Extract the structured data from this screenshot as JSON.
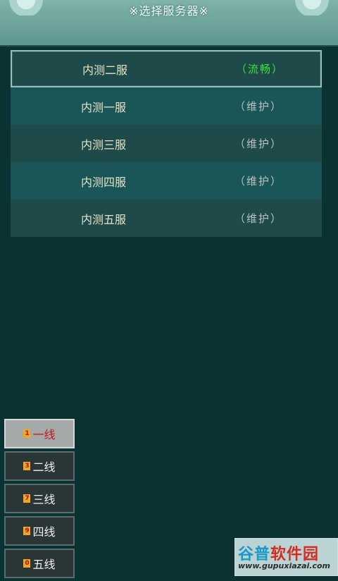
{
  "header": {
    "title": "※选择服务器※"
  },
  "servers": [
    {
      "name": "内测二服",
      "status": "（流畅）",
      "state": "ok"
    },
    {
      "name": "内测一服",
      "status": "（维护）",
      "state": "maintenance"
    },
    {
      "name": "内测三服",
      "status": "（维护）",
      "state": "maintenance"
    },
    {
      "name": "内测四服",
      "status": "（维护）",
      "state": "maintenance"
    },
    {
      "name": "内测五服",
      "status": "（维护）",
      "state": "maintenance"
    }
  ],
  "lines": [
    {
      "key": "1",
      "label": "一线"
    },
    {
      "key": "3",
      "label": "二线"
    },
    {
      "key": "7",
      "label": "三线"
    },
    {
      "key": "9",
      "label": "四线"
    },
    {
      "key": "0",
      "label": "五线"
    }
  ],
  "watermark": {
    "logo_a": "谷普",
    "logo_b": "软件园",
    "url": "www.gupuxiazai.com"
  },
  "colors": {
    "status_ok": "#3ee03e",
    "status_maintenance": "#b9c3c0",
    "active_line_text": "#c0171b"
  }
}
